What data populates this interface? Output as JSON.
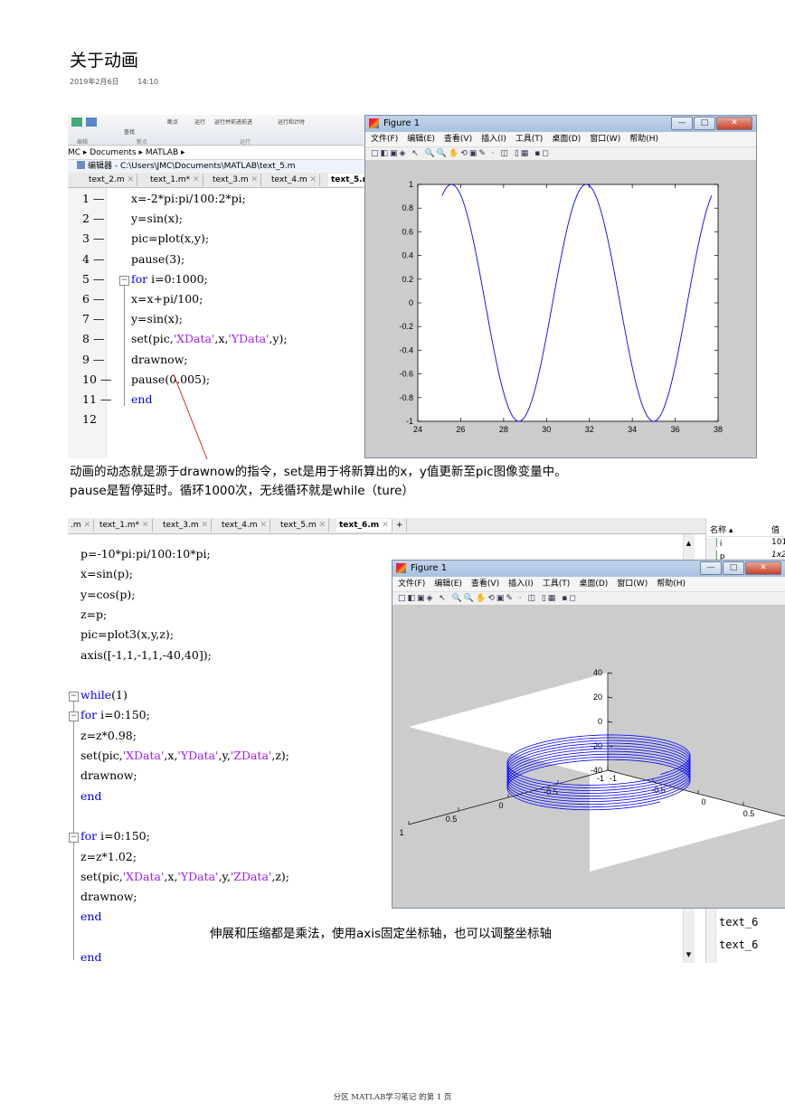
{
  "page": {
    "title": "关于动画",
    "date": "2019年2月6日",
    "time": "14:10",
    "note1_line1": "动画的动态就是源于drawnow的指令，set是用于将新算出的x，y值更新至pic图像变量中。",
    "note1_line2": "pause是暂停延时。循环1000次，无线循环就是while（ture）",
    "note2": "伸展和压缩都是乘法，使用axis固定坐标轴，也可以调整坐标轴",
    "footer": "分区 MATLAB学习笔记 的第 1 页"
  },
  "screen1": {
    "ribbon": {
      "items": [
        "断点",
        "运行",
        "运行并前进",
        "前进",
        "运行和计时",
        "查找"
      ],
      "groups": [
        "编辑",
        "断点",
        "运行"
      ]
    },
    "breadcrumb": "MC ▸ Documents ▸ MATLAB ▸",
    "editor_title": "编辑器 - C:\\Users\\JMC\\Documents\\MATLAB\\text_5.m",
    "tabs": [
      "text_2.m",
      "text_1.m*",
      "text_3.m",
      "text_4.m",
      "text_5.m"
    ],
    "line_numbers": [
      "1 —",
      "2 —",
      "3 —",
      "4 —",
      "5 —",
      "6 —",
      "7 —",
      "8 —",
      "9 —",
      "10 —",
      "11 —",
      "12"
    ],
    "code": [
      "x=-2*pi:pi/100:2*pi;",
      "y=sin(x);",
      "pic=plot(x,y);",
      "pause(3);",
      "for i=0:1000;",
      "x=x+pi/100;",
      "y=sin(x);",
      "set(pic,'XData',x,'YData',y);",
      "drawnow;",
      "pause(0.005);",
      "end"
    ],
    "figure": {
      "title": "Figure 1",
      "win_min": "—",
      "win_max": "□",
      "win_close": "✕",
      "menu": [
        "文件(F)",
        "编辑(E)",
        "查看(V)",
        "插入(I)",
        "工具(T)",
        "桌面(D)",
        "窗口(W)",
        "帮助(H)"
      ],
      "toolbar_icons": "□◧▣◈ ↖ 🔍🔍✋⟲▣✎ · ◫ ▯▦ ▪◻"
    }
  },
  "screen2": {
    "tabs": [
      ".m",
      "text_1.m*",
      "text_3.m",
      "text_4.m",
      "text_5.m",
      "text_6.m",
      "+"
    ],
    "workspace_header": [
      "名称 ▴",
      "值"
    ],
    "workspace_rows": [
      [
        "i",
        "101"
      ],
      [
        "p",
        "1x2"
      ]
    ],
    "side_items": [
      "text_6",
      "text_6"
    ],
    "code": [
      "p=-10*pi:pi/100:10*pi;",
      "x=sin(p);",
      "y=cos(p);",
      "z=p;",
      "pic=plot3(x,y,z);",
      "axis([-1,1,-1,1,-40,40]);",
      "while(1)",
      "for i=0:150;",
      "z=z*0.98;",
      "set(pic,'XData',x,'YData',y,'ZData',z);",
      "drawnow;",
      "end",
      "for i=0:150;",
      "z=z*1.02;",
      "set(pic,'XData',x,'YData',y,'ZData',z);",
      "drawnow;",
      "end",
      "end"
    ],
    "figure": {
      "title": "Figure 1",
      "win_min": "—",
      "win_max": "□",
      "win_close": "✕",
      "menu": [
        "文件(F)",
        "编辑(E)",
        "查看(V)",
        "插入(I)",
        "工具(T)",
        "桌面(D)",
        "窗口(W)",
        "帮助(H)"
      ],
      "toolbar_icons": "□◧▣◈ ↖ 🔍🔍✋⟲▣✎ · ◫ ▯▦ ▪◻"
    }
  },
  "chart_data": [
    {
      "type": "line",
      "series": [
        {
          "function": "sin(x - 24)",
          "x_range": [
            25.13,
            37.7
          ]
        }
      ],
      "xlim": [
        24,
        38
      ],
      "ylim": [
        -1,
        1
      ],
      "xticks": [
        "24",
        "26",
        "28",
        "30",
        "32",
        "34",
        "36",
        "38"
      ],
      "yticks": [
        "-1",
        "-0.8",
        "-0.6",
        "-0.4",
        "-0.2",
        "0",
        "0.2",
        "0.4",
        "0.6",
        "0.8",
        "1"
      ],
      "line_color": "#0000ff",
      "grid": false
    },
    {
      "type": "line",
      "series": [
        {
          "function": "helix x=sin(p), y=cos(p), z=p*0.98^k",
          "turns": 10,
          "z_range": [
            -9,
            9
          ]
        }
      ],
      "zlim": [
        -40,
        40
      ],
      "xlim": [
        -1,
        1
      ],
      "ylim": [
        -1,
        1
      ],
      "zticks": [
        "-40",
        "-20",
        "0",
        "20",
        "40"
      ],
      "xticks": [
        "-1",
        "-0.5",
        "0",
        "0.5",
        "1"
      ],
      "yticks": [
        "-1",
        "-0.5",
        "0",
        "0.5",
        "1"
      ],
      "line_color": "#0000ff",
      "grid": false
    }
  ]
}
